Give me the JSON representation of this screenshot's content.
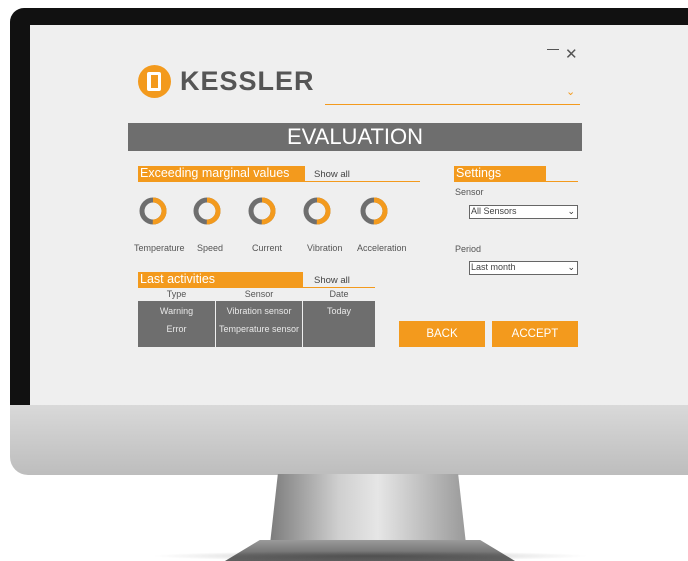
{
  "colors": {
    "accent": "#f39a1d",
    "dark": "#6e6e6e",
    "screen_bg": "#efefef"
  },
  "window": {
    "minimize_icon": "minimize-icon",
    "close_icon": "close-icon",
    "close_glyph": "✕"
  },
  "header": {
    "brand": "KESSLER",
    "dropdown_icon": "chevron-down-icon"
  },
  "title": "EVALUATION",
  "exceeding": {
    "heading": "Exceeding marginal values",
    "show_all": "Show all",
    "gauges": [
      {
        "label": "Temperature",
        "level": 0.5
      },
      {
        "label": "Speed",
        "level": 0.5
      },
      {
        "label": "Current",
        "level": 0.5
      },
      {
        "label": "Vibration",
        "level": 0.5
      },
      {
        "label": "Acceleration",
        "level": 0.5
      }
    ]
  },
  "activities": {
    "heading": "Last activities",
    "show_all": "Show all",
    "columns": [
      "Type",
      "Sensor",
      "Date"
    ],
    "rows": [
      {
        "type": "Warning",
        "sensor": "Vibration sensor",
        "date": "Today"
      },
      {
        "type": "Error",
        "sensor": "Temperature sensor",
        "date": ""
      }
    ]
  },
  "settings": {
    "heading": "Settings",
    "sensor_label": "Sensor",
    "sensor_value": "All Sensors",
    "period_label": "Period",
    "period_value": "Last month"
  },
  "buttons": {
    "back": "BACK",
    "accept": "ACCEPT"
  }
}
